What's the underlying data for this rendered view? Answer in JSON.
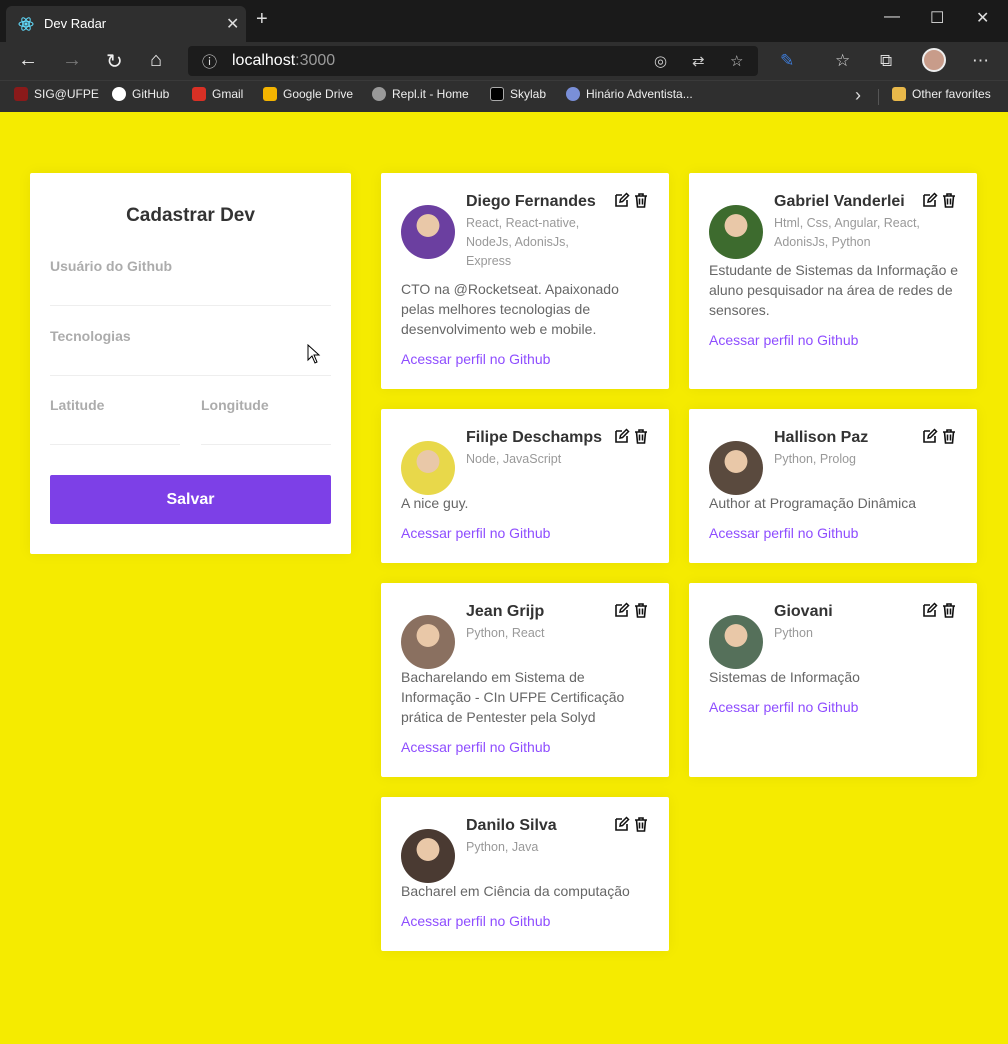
{
  "browser": {
    "tab_title": "Dev Radar",
    "address_host": "localhost",
    "address_port": ":3000",
    "bookmarks": [
      "SIG@UFPE",
      "GitHub",
      "Gmail",
      "Google Drive",
      "Repl.it - Home",
      "Skylab",
      "Hinário Adventista..."
    ],
    "other_favorites": "Other favorites"
  },
  "form": {
    "title": "Cadastrar Dev",
    "github_label": "Usuário do Github",
    "techs_label": "Tecnologias",
    "latitude_label": "Latitude",
    "longitude_label": "Longitude",
    "github_value": "",
    "techs_value": "",
    "latitude_value": "",
    "longitude_value": "",
    "submit_label": "Salvar"
  },
  "devs": [
    {
      "name": "Diego Fernandes",
      "techs": "React, React-native, NodeJs, AdonisJs, Express",
      "bio": "CTO na @Rocketseat. Apaixonado pelas melhores tecnologias de desenvolvimento web e mobile.",
      "link": "Acessar perfil no Github",
      "avatar_color": "#6b3fa0"
    },
    {
      "name": "Gabriel Vanderlei",
      "techs": "Html, Css, Angular, React, AdonisJs, Python",
      "bio": "Estudante de Sistemas da Informação e aluno pesquisador na área de redes de sensores.",
      "link": "Acessar perfil no Github",
      "avatar_color": "#3d6b2e"
    },
    {
      "name": "Filipe Deschamps",
      "techs": "Node, JavaScript",
      "bio": "A nice guy.",
      "link": "Acessar perfil no Github",
      "avatar_color": "#e8d84a"
    },
    {
      "name": "Hallison Paz",
      "techs": "Python, Prolog",
      "bio": "Author at Programação Dinâmica",
      "link": "Acessar perfil no Github",
      "avatar_color": "#5a4a3e"
    },
    {
      "name": "Jean Grijp",
      "techs": "Python, React",
      "bio": "Bacharelando em Sistema de Informação - CIn UFPE Certificação prática de Pentester pela Solyd",
      "link": "Acessar perfil no Github",
      "avatar_color": "#8a7060"
    },
    {
      "name": "Giovani",
      "techs": "Python",
      "bio": "Sistemas de Informação",
      "link": "Acessar perfil no Github",
      "avatar_color": "#55705a"
    },
    {
      "name": "Danilo Silva",
      "techs": "Python, Java",
      "bio": "Bacharel em Ciência da computação",
      "link": "Acessar perfil no Github",
      "avatar_color": "#4a3a32"
    }
  ],
  "colors": {
    "background": "#f5eb00",
    "primary": "#7d40e7",
    "link": "#8e4dff"
  }
}
